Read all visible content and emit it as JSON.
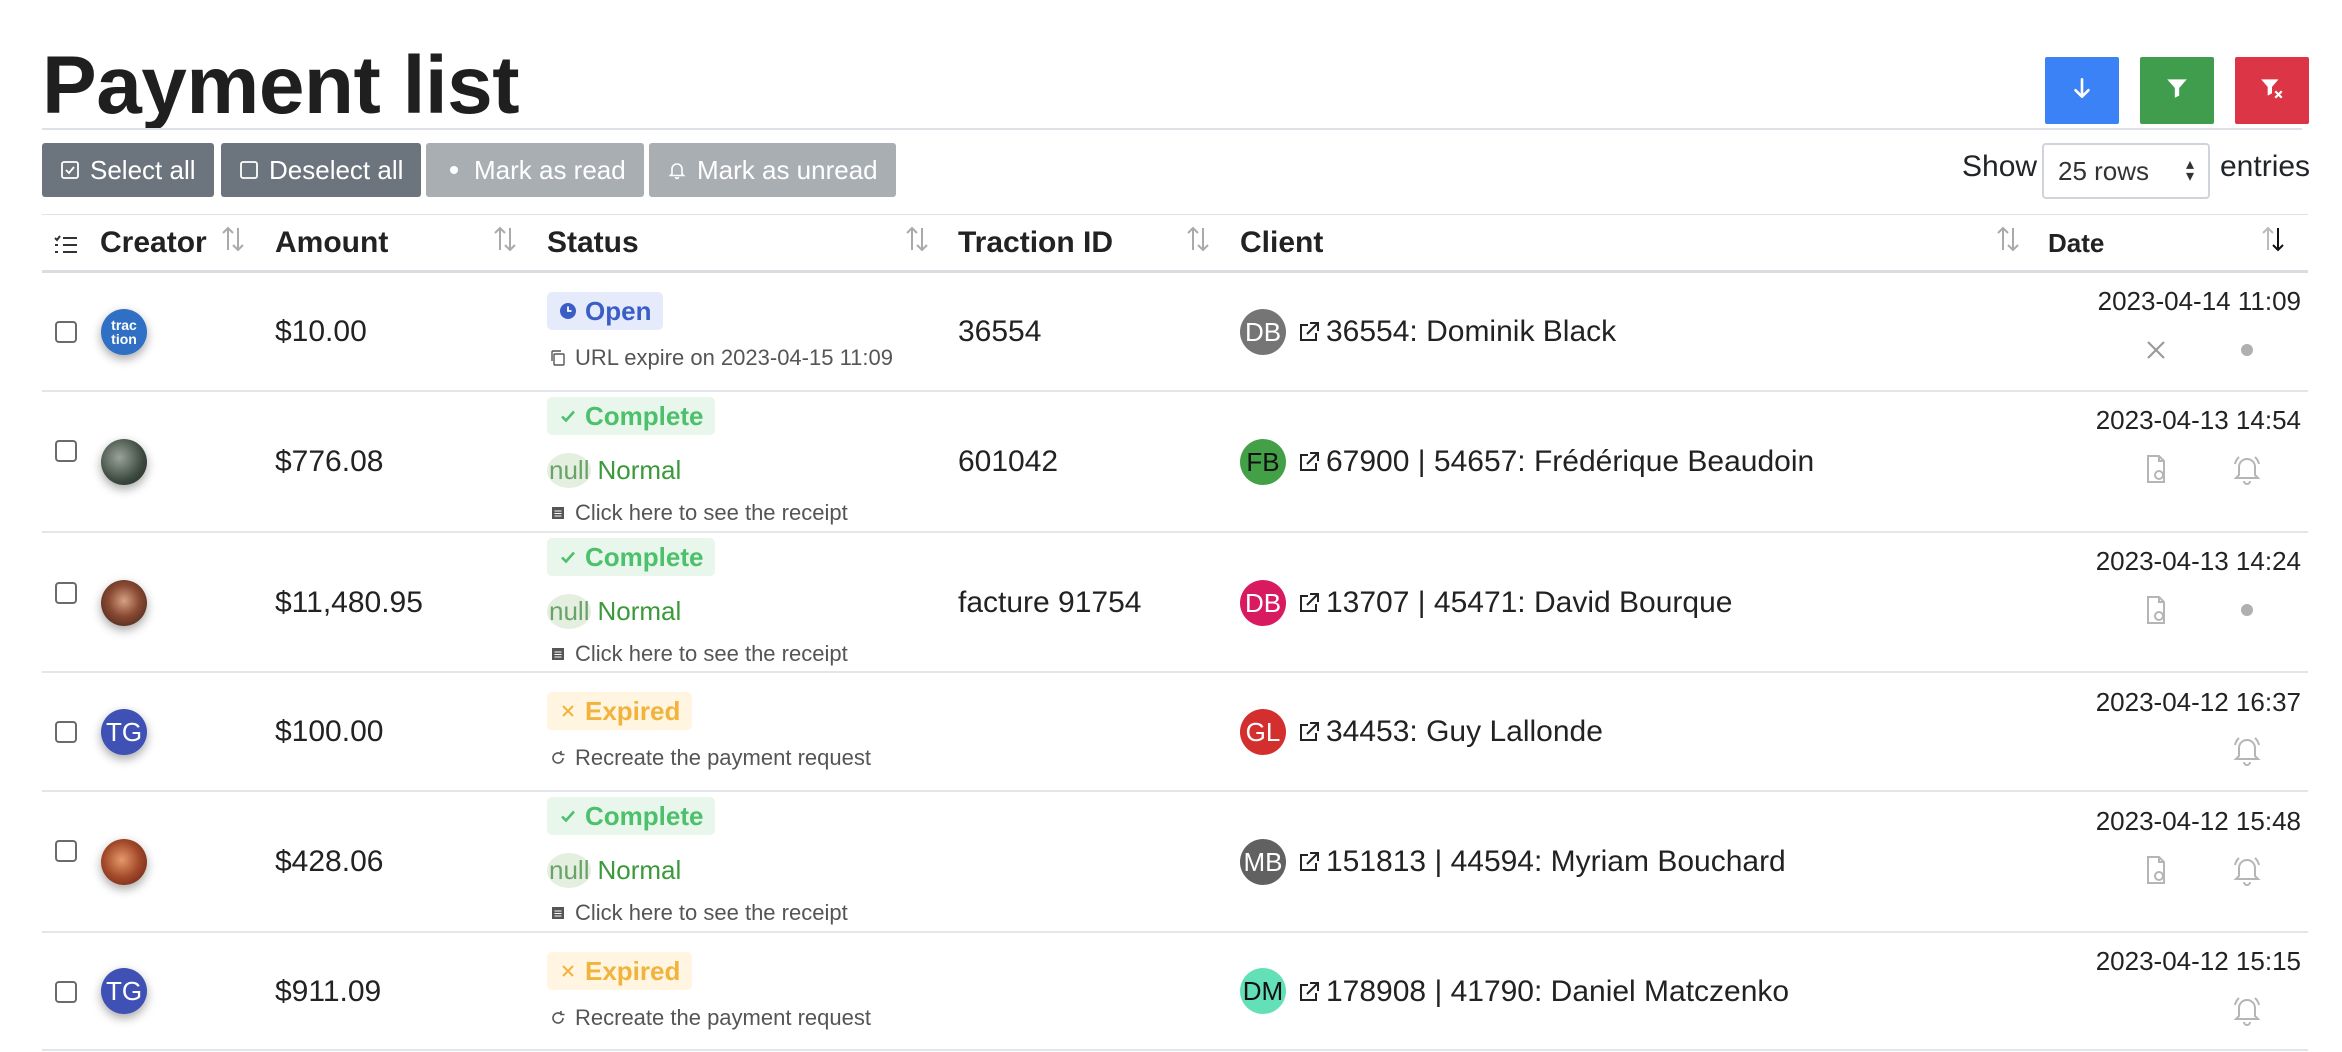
{
  "page": {
    "title": "Payment list"
  },
  "top_actions": [
    {
      "name": "sort-down-button",
      "icon": "arrow-down-icon",
      "color": "#3b82f6"
    },
    {
      "name": "filter-button",
      "icon": "filter-icon",
      "color": "#3f9d4d"
    },
    {
      "name": "clear-filter-button",
      "icon": "filter-clear-icon",
      "color": "#dc3545"
    }
  ],
  "toolbar": {
    "select_all": "Select all",
    "deselect_all": "Deselect all",
    "mark_read": "Mark as read",
    "mark_unread": "Mark as unread"
  },
  "pagination": {
    "show_label": "Show",
    "rows_value": "25 rows",
    "entries_label": "entries"
  },
  "table": {
    "columns": {
      "creator": "Creator",
      "amount": "Amount",
      "status": "Status",
      "traction_id": "Traction ID",
      "client": "Client",
      "date": "Date"
    },
    "rows": [
      {
        "avatar": "trac\ntion",
        "amount": "$10.00",
        "status": "Open",
        "status_type": "open",
        "sub_text": "URL expire on 2023-04-15 11:09",
        "traction_id": "36554",
        "client_initials": "DB",
        "client_color": "#757575",
        "client_name": "36554: Dominik Black",
        "date": "2023-04-14 11:09"
      },
      {
        "amount": "$776.08",
        "status": "Complete",
        "status_type": "complete",
        "priority_null": "null",
        "priority": "Normal",
        "sub_text": "Click here to see the receipt",
        "traction_id": "601042",
        "client_initials": "FB",
        "client_color": "#43a047",
        "client_name": "67900 | 54657: Frédérique Beaudoin",
        "date": "2023-04-13 14:54"
      },
      {
        "amount": "$11,480.95",
        "status": "Complete",
        "status_type": "complete",
        "priority_null": "null",
        "priority": "Normal",
        "sub_text": "Click here to see the receipt",
        "traction_id": "facture 91754",
        "client_initials": "DB",
        "client_color": "#d81b60",
        "client_name": "13707 | 45471: David Bourque",
        "date": "2023-04-13 14:24"
      },
      {
        "avatar": "TG",
        "amount": "$100.00",
        "status": "Expired",
        "status_type": "expired",
        "sub_text": "Recreate the payment request",
        "traction_id": "",
        "client_initials": "GL",
        "client_color": "#d32f2f",
        "client_name": "34453: Guy Lallonde",
        "date": "2023-04-12 16:37"
      },
      {
        "amount": "$428.06",
        "status": "Complete",
        "status_type": "complete",
        "priority_null": "null",
        "priority": "Normal",
        "sub_text": "Click here to see the receipt",
        "traction_id": "",
        "client_initials": "MB",
        "client_color": "#616161",
        "client_name": "151813 | 44594: Myriam Bouchard",
        "date": "2023-04-12 15:48"
      },
      {
        "avatar": "TG",
        "amount": "$911.09",
        "status": "Expired",
        "status_type": "expired",
        "sub_text": "Recreate the payment request",
        "traction_id": "",
        "client_initials": "DM",
        "client_color": "#64e0b8",
        "client_name": "178908 | 41790: Daniel Matczenko",
        "date": "2023-04-12 15:15"
      }
    ]
  }
}
